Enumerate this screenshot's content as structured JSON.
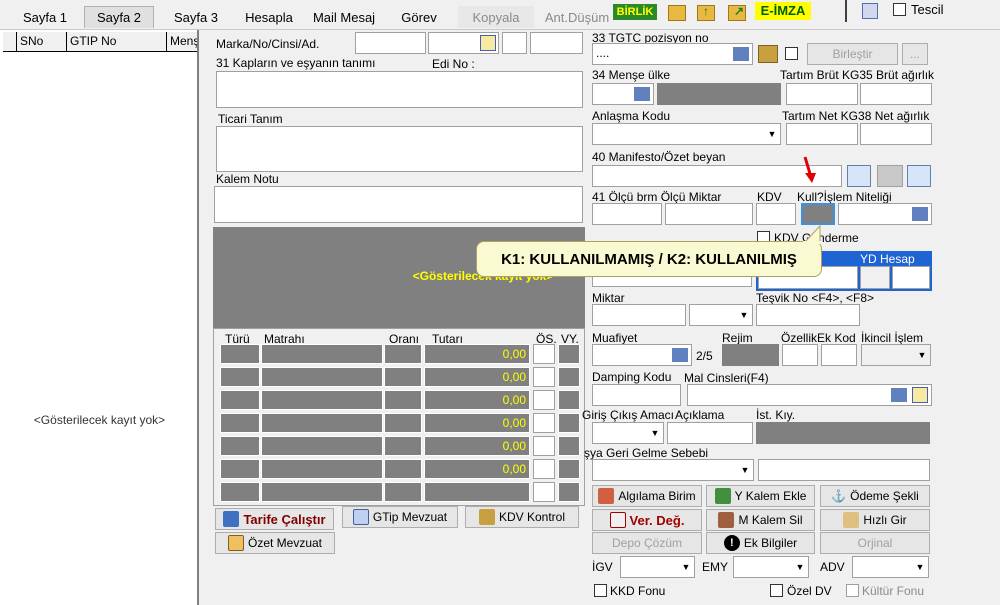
{
  "tabs": [
    {
      "label": "Sayfa 1",
      "state": "normal"
    },
    {
      "label": "Sayfa 2",
      "state": "active"
    },
    {
      "label": "Sayfa 3",
      "state": "normal"
    },
    {
      "label": "Hesapla",
      "state": "normal"
    },
    {
      "label": "Mail Mesaj",
      "state": "normal"
    },
    {
      "label": "Görev",
      "state": "normal"
    },
    {
      "label": "Kopyala",
      "state": "disabled"
    },
    {
      "label": "Ant.Düşüm",
      "state": "disabled"
    }
  ],
  "toolbar": {
    "birlik": "BİRLİK",
    "eimza": "E-İMZA",
    "tescil": "Tescil"
  },
  "list": {
    "columns": [
      "SNo",
      "GTIP No",
      "Menş"
    ],
    "empty_text": "<Gösterilecek kayıt yok>"
  },
  "form": {
    "marka_label": "Marka/No/Cinsi/Ad.",
    "kaplar_label": "31 Kapların ve eşyanın tanımı",
    "edino_label": "Edi No :",
    "ticari_label": "Ticari Tanım",
    "kalem_notu_label": "Kalem Notu",
    "grid_empty": "<Gösterilecek kayıt yok>",
    "tgtc_label": "33 TGTC pozisyon no",
    "tgtc_value": "....",
    "birlestir": "Birleştir",
    "dots": "...",
    "mense_label": "34 Menşe ülke",
    "tartim_brut_label": "Tartım Brüt KG35 Brüt ağırlık",
    "anlasma_label": "Anlaşma Kodu",
    "tartim_net_label": "Tartım Net KG38 Net ağırlık",
    "manifesto_label": "40 Manifesto/Özet beyan",
    "olcu_label": "41 Ölçü brm Ölçü Miktar",
    "kdv_label": "KDV",
    "kull_label": "Kull?İşlem Niteliği",
    "kdv_gonderme": "KDV Gönderme",
    "ydhesap": "YD Hesap",
    "miktar_label": "Miktar",
    "tesvik_label": "Teşvik No <F4>, <F8>",
    "muafiyet_label": "Muafiyet",
    "muafiyet_val": "2/5",
    "rejim_label": "Rejim",
    "ozellik_label": "Özellik",
    "ekkod_label": "Ek Kod",
    "ikincil_label": "İkincil İşlem",
    "damping_label": "Damping Kodu",
    "malcins_label": "Mal Cinsleri(F4)",
    "giris_label": "Giriş Çıkış Amacı",
    "aciklama_label": "Açıklama",
    "istkiy_label": "İst. Kıy.",
    "geri_label": "şya Geri Gelme Sebebi",
    "callout": "K1: KULLANILMAMIŞ / K2: KULLANILMIŞ"
  },
  "tax_grid": {
    "headers": [
      "Türü",
      "Matrahı",
      "Oranı",
      "Tutarı",
      "ÖS.",
      "VY."
    ],
    "rows": [
      "0,00",
      "0,00",
      "0,00",
      "0,00",
      "0,00",
      "0,00"
    ]
  },
  "buttons": {
    "tarife": "Tarife Çalıştır",
    "gtip": "GTip Mevzuat",
    "kdvkontrol": "KDV Kontrol",
    "ozetmevzuat": "Özet Mevzuat",
    "algilama": "Algılama Birim",
    "yeni_kalem": "Y Kalem Ekle",
    "odeme": "Ödeme Şekli",
    "verdeg": "Ver. Değ.",
    "kalem_sil": "M Kalem Sil",
    "hizli_gir": "Hızlı Gir",
    "depo": "Depo Çözüm",
    "ek_bilgiler": "Ek Bilgiler",
    "orjinal": "Orjinal"
  },
  "bottom": {
    "igv": "İGV",
    "emy": "EMY",
    "adv": "ADV",
    "kkd": "KKD Fonu",
    "ozel_dv": "Özel DV",
    "kultur": "Kültür Fonu"
  },
  "colors": {
    "panel_gray": "#808080",
    "grid_yellow": "#ffff00",
    "arrow_red": "#e00000",
    "ydhesap_blue": "#1e64d2",
    "callout_bg": "#fafad2"
  }
}
